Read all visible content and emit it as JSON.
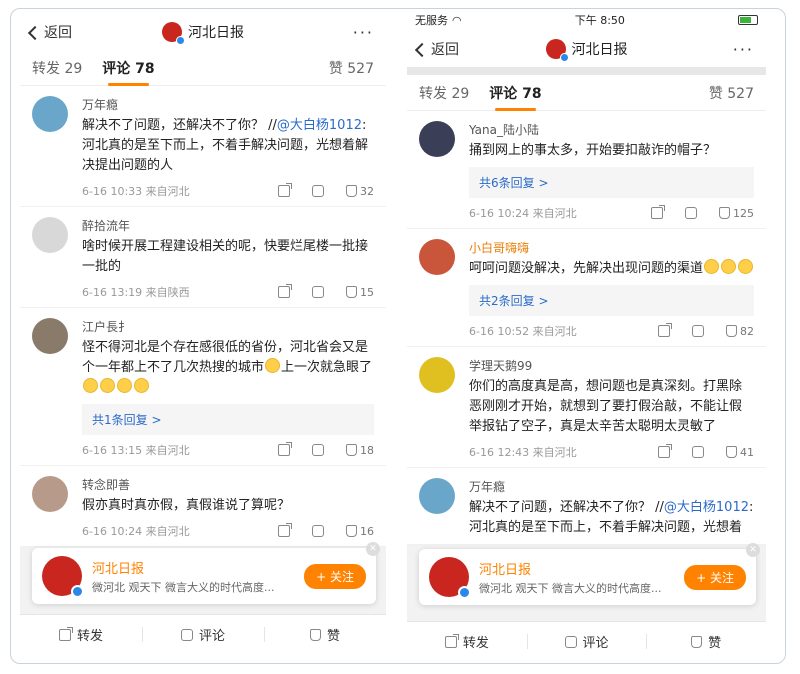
{
  "left": {
    "back_label": "返回",
    "title": "河北日报",
    "logo_text": "河北日报",
    "more_label": "···",
    "tabs": {
      "repost": "转发 29",
      "comment": "评论 78",
      "likes": "赞 527"
    },
    "comments": [
      {
        "name": "万年瘾",
        "parts": [
          {
            "t": "解决不了问题，还解决不了你？ //"
          },
          {
            "m": "@大白杨1012"
          },
          {
            "t": ":河北真的是至下而上，不着手解决问题，光想着解决提出问题的人"
          }
        ],
        "emojis": 0,
        "time": "6-16 10:33  来自河北",
        "likes": "32",
        "avatar_color": "#6aa6c9"
      },
      {
        "name": "醉拾流年",
        "parts": [
          {
            "t": "啥时候开展工程建设相关的呢，快要烂尾楼一批接一批的"
          }
        ],
        "emojis": 0,
        "time": "6-16 13:19  来自陕西",
        "likes": "15",
        "avatar_color": "#d8d8d8"
      },
      {
        "name": "江户長扌",
        "parts": [
          {
            "t": "怪不得河北是个存在感很低的省份，河北省会又是个一年都上不了几次热搜的城市"
          }
        ],
        "mid_emoji": true,
        "tail_text": "上一次就急眼了",
        "emojis": 4,
        "replies": "共1条回复 >",
        "time": "6-16 13:15  来自河北",
        "likes": "18",
        "avatar_color": "#8a7a6a"
      },
      {
        "name": "转念即善",
        "parts": [
          {
            "t": "假亦真时真亦假，真假谁说了算呢？"
          }
        ],
        "emojis": 0,
        "time": "6-16 10:24  来自河北",
        "likes": "16",
        "avatar_color": "#b89a8a"
      }
    ],
    "promo": {
      "name": "河北日报",
      "desc": "微河北 观天下 微言大义的时代高度...",
      "follow": "+ 关注",
      "logo_text": "河北日报"
    },
    "bottom": {
      "repost": "转发",
      "comment": "评论",
      "like": "赞"
    }
  },
  "right": {
    "status": {
      "carrier": "无服务",
      "time": "下午 8:50"
    },
    "back_label": "返回",
    "title": "河北日报",
    "logo_text": "河北日报",
    "more_label": "···",
    "tabs": {
      "repost": "转发 29",
      "comment": "评论 78",
      "likes": "赞 527"
    },
    "comments": [
      {
        "name": "Yana_陆小陆",
        "vip": false,
        "parts": [
          {
            "t": "捅到网上的事太多，开始要扣敲诈的帽子？"
          }
        ],
        "emojis": 0,
        "replies": "共6条回复 >",
        "time": "6-16 10:24  来自河北",
        "likes": "125",
        "avatar_color": "#3a3f57"
      },
      {
        "name": "小白哥嗨嗨",
        "vip": true,
        "parts": [
          {
            "t": "呵呵问题没解决，先解决出现问题的渠道"
          }
        ],
        "emojis": 3,
        "replies": "共2条回复 >",
        "time": "6-16 10:52  来自河北",
        "likes": "82",
        "avatar_color": "#c9553a"
      },
      {
        "name": "学理天鹅99",
        "vip": false,
        "parts": [
          {
            "t": "你们的高度真是高，想问题也是真深刻。打黑除恶刚刚才开始，就想到了要打假治敲，不能让假举报钻了空子，真是太辛苦太聪明太灵敏了"
          }
        ],
        "emojis": 0,
        "time": "6-16 12:43  来自河北",
        "likes": "41",
        "avatar_color": "#e0c020"
      },
      {
        "name": "万年瘾",
        "vip": false,
        "parts": [
          {
            "t": "解决不了问题，还解决不了你？ //"
          },
          {
            "m": "@大白杨1012"
          },
          {
            "t": ":河北真的是至下而上，不着手解决问题，光想着"
          }
        ],
        "emojis": 0,
        "avatar_color": "#6aa6c9"
      }
    ],
    "promo": {
      "name": "河北日报",
      "desc": "微河北 观天下 微言大义的时代高度...",
      "follow": "+ 关注",
      "logo_text": "河北日报"
    },
    "bottom": {
      "repost": "转发",
      "comment": "评论",
      "like": "赞"
    }
  }
}
